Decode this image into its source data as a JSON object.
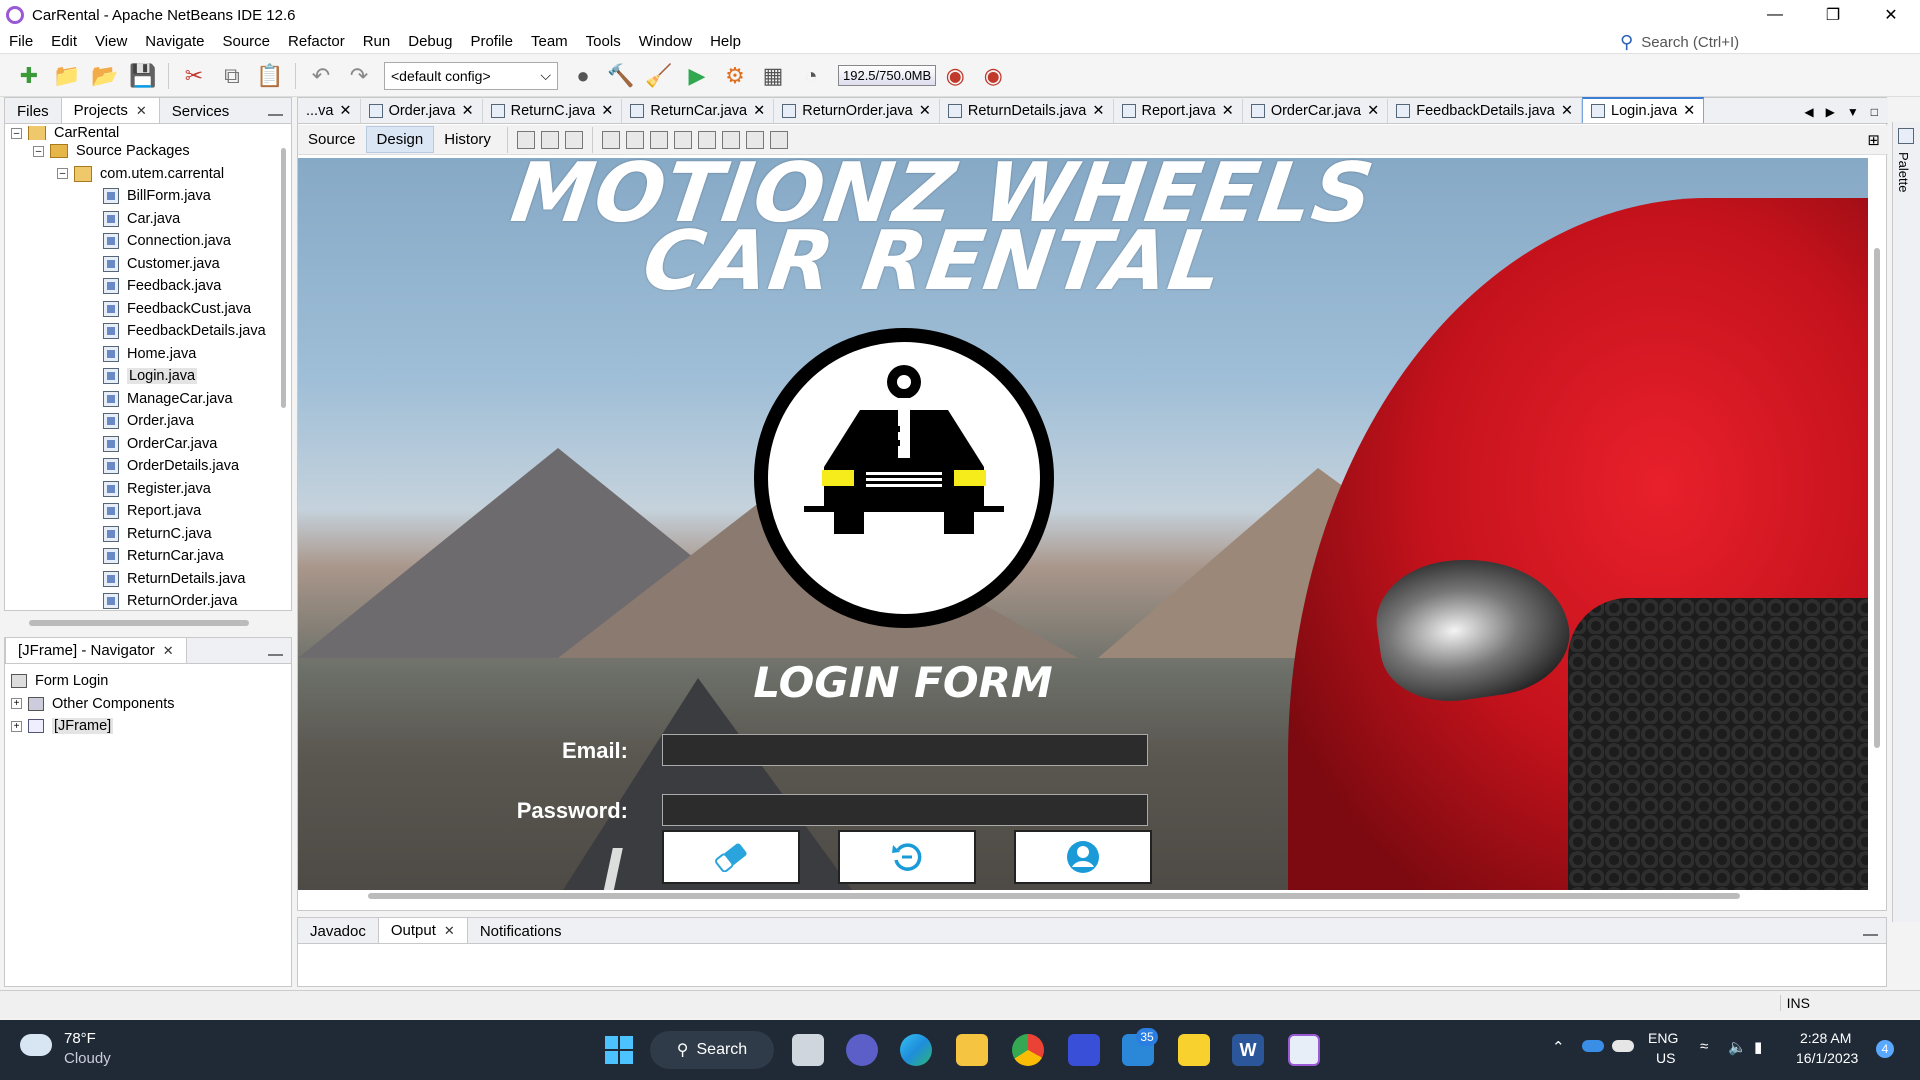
{
  "window": {
    "title": "CarRental - Apache NetBeans IDE 12.6"
  },
  "menu": [
    "File",
    "Edit",
    "View",
    "Navigate",
    "Source",
    "Refactor",
    "Run",
    "Debug",
    "Profile",
    "Team",
    "Tools",
    "Window",
    "Help"
  ],
  "search": {
    "placeholder": "Search (Ctrl+I)"
  },
  "toolbar": {
    "config": "<default config>",
    "memory": "192.5/750.0MB"
  },
  "left_tabs": [
    "Files",
    "Projects",
    "Services"
  ],
  "project_tree": {
    "root": "CarRental",
    "source_packages": "Source Packages",
    "package": "com.utem.carrental",
    "files": [
      "BillForm.java",
      "Car.java",
      "Connection.java",
      "Customer.java",
      "Feedback.java",
      "FeedbackCust.java",
      "FeedbackDetails.java",
      "Home.java",
      "Login.java",
      "ManageCar.java",
      "Order.java",
      "OrderCar.java",
      "OrderDetails.java",
      "Register.java",
      "Report.java",
      "ReturnC.java",
      "ReturnCar.java",
      "ReturnDetails.java",
      "ReturnOrder.java"
    ],
    "selected": "Login.java"
  },
  "navigator": {
    "tab": "[JFrame] - Navigator",
    "items": [
      "Form Login",
      "Other Components",
      "[JFrame]"
    ]
  },
  "editor_tabs": [
    "...va",
    "Order.java",
    "ReturnC.java",
    "ReturnCar.java",
    "ReturnOrder.java",
    "ReturnDetails.java",
    "Report.java",
    "OrderCar.java",
    "FeedbackDetails.java",
    "Login.java"
  ],
  "active_editor_tab": "Login.java",
  "design_modes": [
    "Source",
    "Design",
    "History"
  ],
  "form": {
    "title_line1": "MOTIONZ WHEELS",
    "title_line2": "CAR RENTAL",
    "heading": "LOGIN FORM",
    "email_label": "Email:",
    "password_label": "Password:",
    "email_value": "",
    "password_value": ""
  },
  "palette_label": "Palette",
  "bottom_tabs": [
    "Javadoc",
    "Output",
    "Notifications"
  ],
  "status": {
    "mode": "INS"
  },
  "taskbar": {
    "weather_temp": "78°F",
    "weather_desc": "Cloudy",
    "search": "Search",
    "teams_badge": "35",
    "lang": "ENG",
    "region": "US",
    "time": "2:28 AM",
    "date": "16/1/2023",
    "notif_badge": "4"
  }
}
